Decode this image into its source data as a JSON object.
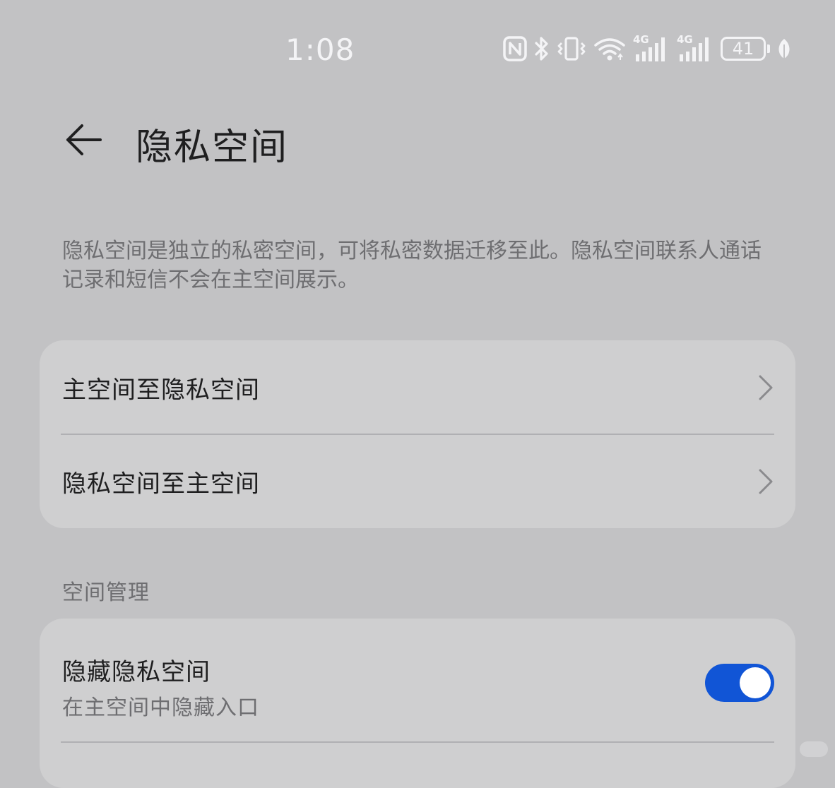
{
  "status_bar": {
    "time": "1:08",
    "battery_level": "41",
    "icons": [
      "nfc-icon",
      "bluetooth-icon",
      "vibrate-icon",
      "wifi-icon",
      "signal-4g-icon",
      "signal-4g-icon",
      "battery-icon",
      "leaf-icon"
    ],
    "network_labels": [
      "4G",
      "4G"
    ]
  },
  "header": {
    "title": "隐私空间",
    "back_icon": "arrow-left-icon"
  },
  "description": "隐私空间是独立的私密空间，可将私密数据迁移至此。隐私空间联系人通话记录和短信不会在主空间展示。",
  "transfer": {
    "items": [
      {
        "label": "主空间至隐私空间",
        "icon": "chevron-right-icon"
      },
      {
        "label": "隐私空间至主空间",
        "icon": "chevron-right-icon"
      }
    ]
  },
  "space_management": {
    "header": "空间管理",
    "hide_private_space": {
      "title": "隐藏隐私空间",
      "subtitle": "在主空间中隐藏入口",
      "enabled": true
    }
  },
  "colors": {
    "background": "#c2c2c4",
    "card": "#cfcfd0",
    "accent": "#1155d6",
    "primary_text": "#1f1f20",
    "secondary_text": "#6e6e71"
  }
}
